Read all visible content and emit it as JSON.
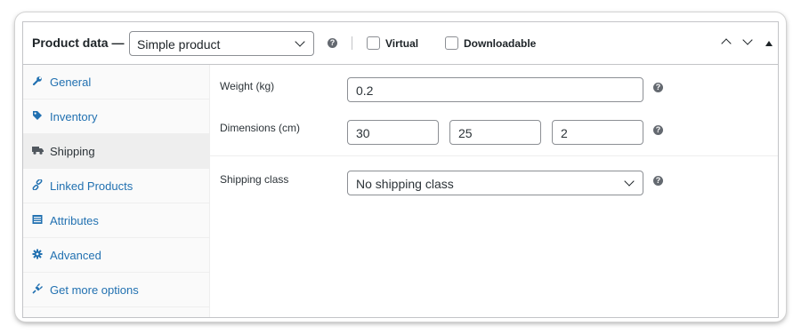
{
  "header": {
    "title": "Product data —",
    "product_type": "Simple product",
    "help_glyph": "?",
    "virtual_label": "Virtual",
    "downloadable_label": "Downloadable",
    "icons": [
      "chevron-up-icon",
      "chevron-down-icon",
      "triangle-up-icon"
    ]
  },
  "tabs": [
    {
      "label": "General",
      "icon": "wrench-icon",
      "active": false
    },
    {
      "label": "Inventory",
      "icon": "tag-icon",
      "active": false
    },
    {
      "label": "Shipping",
      "icon": "truck-icon",
      "active": true
    },
    {
      "label": "Linked Products",
      "icon": "link-icon",
      "active": false
    },
    {
      "label": "Attributes",
      "icon": "list-icon",
      "active": false
    },
    {
      "label": "Advanced",
      "icon": "gear-icon",
      "active": false
    },
    {
      "label": "Get more options",
      "icon": "plugin-icon",
      "active": false
    }
  ],
  "shipping": {
    "weight_label": "Weight (kg)",
    "weight_value": "0.2",
    "dimensions_label": "Dimensions (cm)",
    "length_value": "30",
    "width_value": "25",
    "height_value": "2",
    "class_label": "Shipping class",
    "class_value": "No shipping class"
  },
  "colors": {
    "link": "#2271b1",
    "border": "#c3c4c7",
    "input_border": "#8c8f94",
    "active_tab_bg": "#eeeeee",
    "help_icon": "#646970"
  }
}
